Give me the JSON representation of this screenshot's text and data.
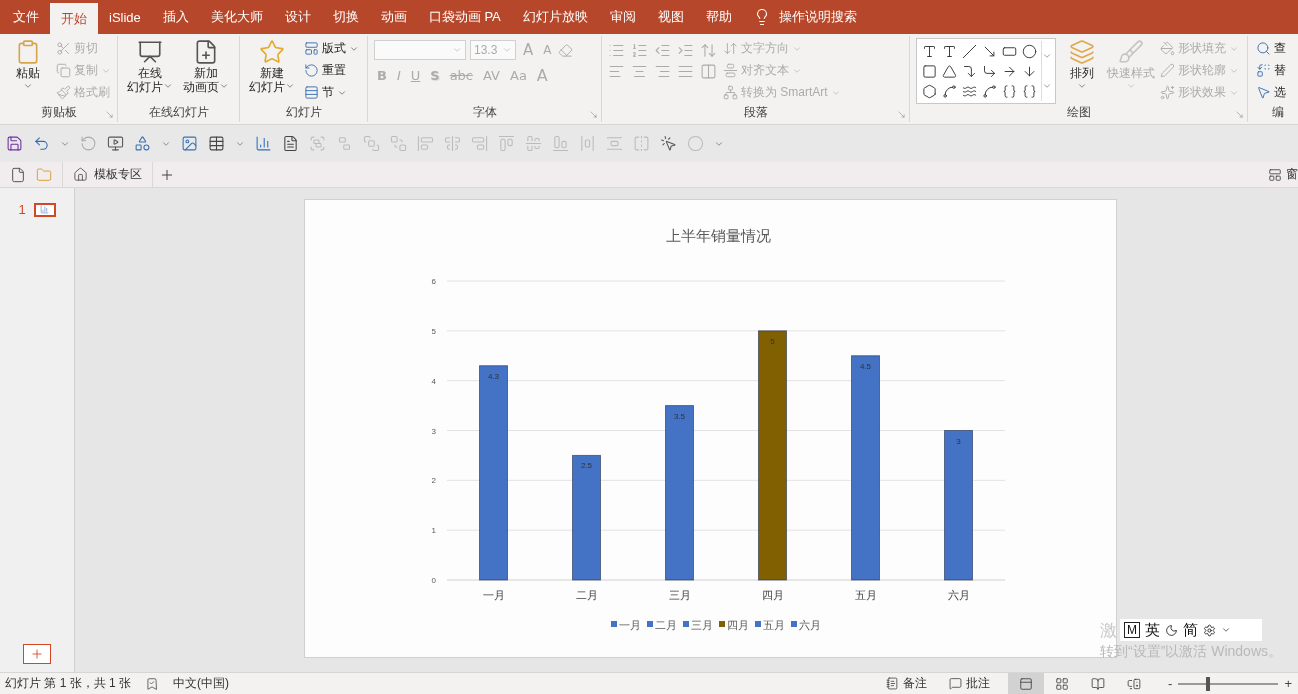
{
  "tabs": [
    {
      "label": "文件",
      "selected": false
    },
    {
      "label": "开始",
      "selected": true
    },
    {
      "label": "iSlide",
      "selected": false
    },
    {
      "label": "插入",
      "selected": false
    },
    {
      "label": "美化大师",
      "selected": false
    },
    {
      "label": "设计",
      "selected": false
    },
    {
      "label": "切换",
      "selected": false
    },
    {
      "label": "动画",
      "selected": false
    },
    {
      "label": "口袋动画 PA",
      "selected": false
    },
    {
      "label": "幻灯片放映",
      "selected": false
    },
    {
      "label": "审阅",
      "selected": false
    },
    {
      "label": "视图",
      "selected": false
    },
    {
      "label": "帮助",
      "selected": false
    }
  ],
  "tell_me": "操作说明搜索",
  "ribbon_groups": [
    {
      "label": "剪贴板",
      "launcher": true,
      "items": [
        {
          "kind": "large",
          "lines": [
            "粘贴"
          ],
          "dropdown": true,
          "disabled": false
        },
        {
          "kind": "stack",
          "items": [
            {
              "label": "剪切",
              "disabled": true,
              "dropdown": false
            },
            {
              "label": "复制",
              "disabled": true,
              "dropdown": true
            },
            {
              "label": "格式刷",
              "disabled": true,
              "dropdown": false
            }
          ]
        }
      ]
    },
    {
      "label": "在线幻灯片",
      "launcher": false,
      "items": [
        {
          "kind": "large",
          "lines": [
            "在线",
            "幻灯片"
          ],
          "dropdown": true,
          "disabled": false
        },
        {
          "kind": "large",
          "lines": [
            "新加",
            "动画页"
          ],
          "dropdown": true,
          "disabled": false
        }
      ]
    },
    {
      "label": "幻灯片",
      "launcher": false,
      "items": [
        {
          "kind": "large",
          "lines": [
            "新建",
            "幻灯片"
          ],
          "dropdown": true,
          "disabled": false
        },
        {
          "kind": "stack",
          "items": [
            {
              "label": "版式",
              "disabled": false,
              "dropdown": true
            },
            {
              "label": "重置",
              "disabled": false,
              "dropdown": false
            },
            {
              "label": "节",
              "disabled": false,
              "dropdown": true
            }
          ]
        }
      ]
    },
    {
      "label": "字体",
      "launcher": true,
      "items": [
        {
          "kind": "font",
          "font_size": "13.3",
          "size_buttons": [
            "A",
            "A"
          ],
          "format_buttons": [
            "B",
            "I",
            "U",
            "S",
            "abc",
            "AV",
            "Aa",
            "A"
          ],
          "disabled": true
        }
      ]
    },
    {
      "label": "段落",
      "launcher": true,
      "items": [
        {
          "kind": "paragraph_icons",
          "disabled": true
        },
        {
          "kind": "stack",
          "items": [
            {
              "label": "文字方向",
              "disabled": true,
              "dropdown": true
            },
            {
              "label": "对齐文本",
              "disabled": true,
              "dropdown": true
            },
            {
              "label": "转换为 SmartArt",
              "disabled": true,
              "dropdown": true
            }
          ]
        }
      ]
    },
    {
      "label": "绘图",
      "launcher": true,
      "items": [
        {
          "kind": "shape_gallery",
          "disabled": false
        },
        {
          "kind": "large",
          "lines": [
            "排列"
          ],
          "dropdown": true,
          "disabled": false
        },
        {
          "kind": "large",
          "lines": [
            "快速样式"
          ],
          "dropdown": true,
          "disabled": true
        },
        {
          "kind": "stack",
          "items": [
            {
              "label": "形状填充",
              "disabled": true,
              "dropdown": true
            },
            {
              "label": "形状轮廓",
              "disabled": true,
              "dropdown": true
            },
            {
              "label": "形状效果",
              "disabled": true,
              "dropdown": true
            }
          ]
        }
      ]
    },
    {
      "label": "编",
      "launcher": false,
      "items": [
        {
          "kind": "stack",
          "items": [
            {
              "label": "查",
              "disabled": false,
              "dropdown": false
            },
            {
              "label": "替",
              "disabled": false,
              "dropdown": false
            },
            {
              "label": "选",
              "disabled": false,
              "dropdown": false
            }
          ]
        }
      ]
    }
  ],
  "doc_tabs": {
    "tab": "模板专区",
    "right_label": "窗"
  },
  "slides_pane": {
    "slides": [
      {
        "number": "1",
        "selected": true
      }
    ]
  },
  "slide": {
    "chart_data": {
      "type": "bar",
      "title": "上半年销量情况",
      "categories": [
        "一月",
        "二月",
        "三月",
        "四月",
        "五月",
        "六月"
      ],
      "series": [
        {
          "name": "一月",
          "color": "#4472c4",
          "values": [
            4.3,
            null,
            null,
            null,
            null,
            null
          ]
        },
        {
          "name": "二月",
          "color": "#4472c4",
          "values": [
            null,
            2.5,
            null,
            null,
            null,
            null
          ]
        },
        {
          "name": "三月",
          "color": "#4472c4",
          "values": [
            null,
            null,
            3.5,
            null,
            null,
            null
          ]
        },
        {
          "name": "四月",
          "color": "#806000",
          "values": [
            null,
            null,
            null,
            5,
            null,
            null
          ]
        },
        {
          "name": "五月",
          "color": "#4472c4",
          "values": [
            null,
            null,
            null,
            null,
            4.5,
            null
          ]
        },
        {
          "name": "六月",
          "color": "#4472c4",
          "values": [
            null,
            null,
            null,
            null,
            null,
            3
          ]
        }
      ],
      "ylim": [
        0,
        6
      ],
      "yticks": [
        0,
        1,
        2,
        3,
        4,
        5,
        6
      ],
      "data_labels": true,
      "grid": true,
      "legend": true
    }
  },
  "ime_bar": {
    "mode_key": "M",
    "language": "英",
    "script": "简"
  },
  "activation": {
    "line_1": "激",
    "line_2": "转到“设置”以激活 Windows。"
  },
  "status_bar": {
    "slide_info": "幻灯片 第 1 张，共 1 张",
    "language": "中文(中国)",
    "notes": "备注",
    "comments": "批注",
    "views": [
      {
        "selected": true
      },
      {
        "selected": false
      },
      {
        "selected": false
      },
      {
        "selected": false
      }
    ],
    "zoom_out": "-",
    "zoom_in": "+",
    "zoom": {
      "level": 0.3
    }
  }
}
